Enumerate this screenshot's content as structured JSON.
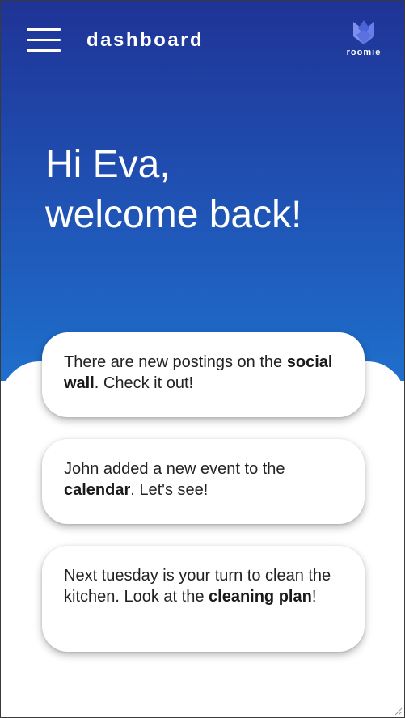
{
  "header": {
    "title": "dashboard",
    "menu_icon": "hamburger-menu-icon",
    "logo": {
      "icon": "roomie-logo-icon",
      "text": "roomie"
    }
  },
  "greeting": {
    "line1": "Hi Eva,",
    "line2": "welcome back!"
  },
  "cards": [
    {
      "before": "There are new postings on the ",
      "link": "social wall",
      "after": ". Check it out!"
    },
    {
      "before": "John added a new event to the ",
      "link": "calendar",
      "after": ". Let's see!"
    },
    {
      "before": "Next tuesday is your turn to clean the kitchen. Look at the ",
      "link": "cleaning plan",
      "after": "!"
    }
  ],
  "colors": {
    "gradient_top": "#1f3396",
    "gradient_bottom": "#1f6fcc",
    "logo_light": "#7f8ff0",
    "logo_dark": "#4a63d6"
  }
}
